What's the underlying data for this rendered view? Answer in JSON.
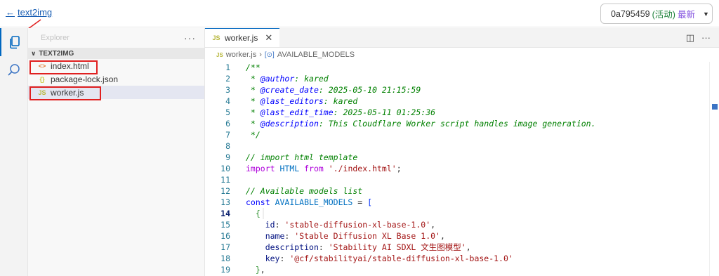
{
  "topbar": {
    "back_label": "text2img",
    "version_id": "0a795459",
    "version_status": "(活动)",
    "version_latest": "最新"
  },
  "sidebar": {
    "header_title": "Explorer",
    "more_label": "···",
    "folder_name": "TEXT2IMG",
    "files": [
      {
        "name": "index.html",
        "icon": "<>"
      },
      {
        "name": "package-lock.json",
        "icon": "{}"
      },
      {
        "name": "worker.js",
        "icon": "JS"
      }
    ]
  },
  "editor": {
    "tab_label": "worker.js",
    "tab_icon": "JS",
    "breadcrumb_file": "worker.js",
    "breadcrumb_symbol": "AVAILABLE_MODELS",
    "code": [
      {
        "n": "1",
        "t": "/**"
      },
      {
        "n": "2",
        "t": " * @author: kared"
      },
      {
        "n": "3",
        "t": " * @create_date: 2025-05-10 21:15:59"
      },
      {
        "n": "4",
        "t": " * @last_editors: kared"
      },
      {
        "n": "5",
        "t": " * @last_edit_time: 2025-05-11 01:25:36"
      },
      {
        "n": "6",
        "t": " * @description: This Cloudflare Worker script handles image generation."
      },
      {
        "n": "7",
        "t": " */"
      },
      {
        "n": "8",
        "t": ""
      },
      {
        "n": "9",
        "t": "// import html template"
      },
      {
        "n": "10",
        "t": "import HTML from './index.html';"
      },
      {
        "n": "11",
        "t": ""
      },
      {
        "n": "12",
        "t": "// Available models list"
      },
      {
        "n": "13",
        "t": "const AVAILABLE_MODELS = ["
      },
      {
        "n": "14",
        "t": "  {"
      },
      {
        "n": "15",
        "t": "    id: 'stable-diffusion-xl-base-1.0',"
      },
      {
        "n": "16",
        "t": "    name: 'Stable Diffusion XL Base 1.0',"
      },
      {
        "n": "17",
        "t": "    description: 'Stability AI SDXL 文生图模型',"
      },
      {
        "n": "18",
        "t": "    key: '@cf/stabilityai/stable-diffusion-xl-base-1.0'"
      },
      {
        "n": "19",
        "t": "  },"
      }
    ]
  },
  "colors": {
    "accent": "#0067c0",
    "annotation_red": "#e02020"
  }
}
